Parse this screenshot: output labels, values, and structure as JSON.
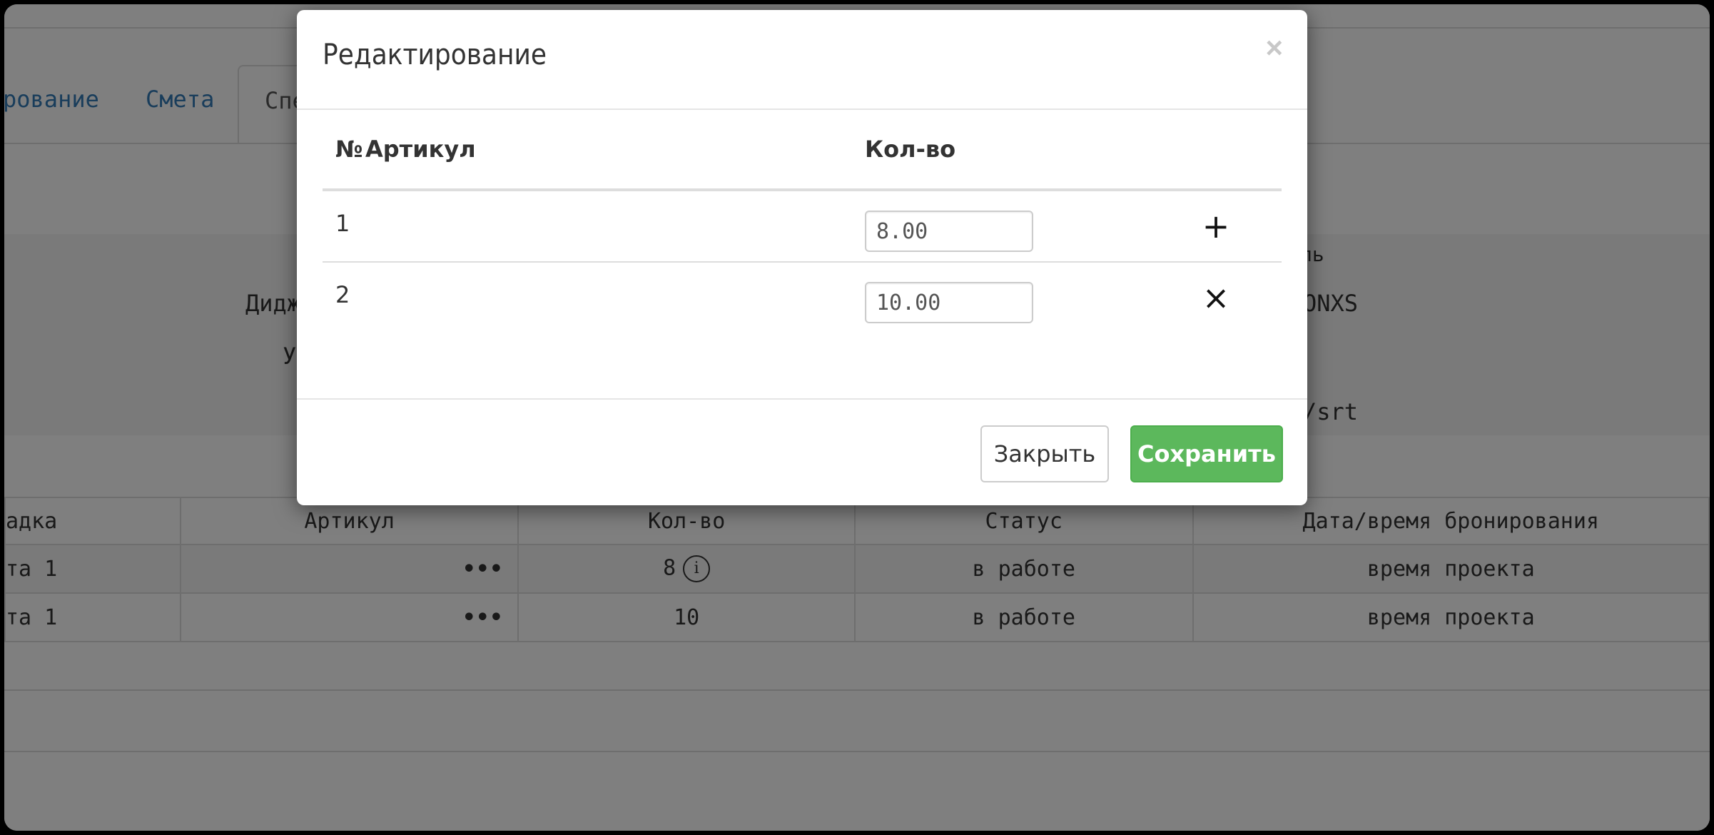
{
  "background": {
    "tabs": [
      {
        "label": "рование"
      },
      {
        "label": "Смета"
      },
      {
        "label": "Спе"
      }
    ],
    "info_labels": {
      "header_fragment": "ль",
      "left_1": "Дидж",
      "left_2": "У",
      "right_1": "ONXS",
      "right_2": "/srt"
    },
    "table": {
      "headers": [
        "адка",
        "Артикул",
        "Кол-во",
        "Статус",
        "Дата/время бронирования"
      ],
      "rows": [
        {
          "col1": "та 1",
          "article": "•••",
          "qty": "8",
          "status": "в работе",
          "datetime": "время проекта"
        },
        {
          "col1": "та 1",
          "article": "•••",
          "qty": "10",
          "status": "в работе",
          "datetime": "время проекта"
        }
      ]
    },
    "info_icon": "i"
  },
  "modal": {
    "title": "Редактирование",
    "close_symbol": "×",
    "table": {
      "headers": {
        "num": "№",
        "article": "Артикул",
        "qty": "Кол-во"
      },
      "rows": [
        {
          "num": "1",
          "article": "",
          "qty": "8.00",
          "action": "+"
        },
        {
          "num": "2",
          "article": "",
          "qty": "10.00",
          "action": "×"
        }
      ]
    },
    "buttons": {
      "close": "Закрыть",
      "save": "Сохранить"
    }
  },
  "icons": {
    "add_row": "plus-icon",
    "remove_row": "close-icon",
    "dismiss": "close-icon",
    "info": "info-circle-icon"
  },
  "colors": {
    "link": "#337ab7",
    "save_button": "#5cb85c",
    "backdrop": "rgba(0,0,0,0.5)"
  }
}
